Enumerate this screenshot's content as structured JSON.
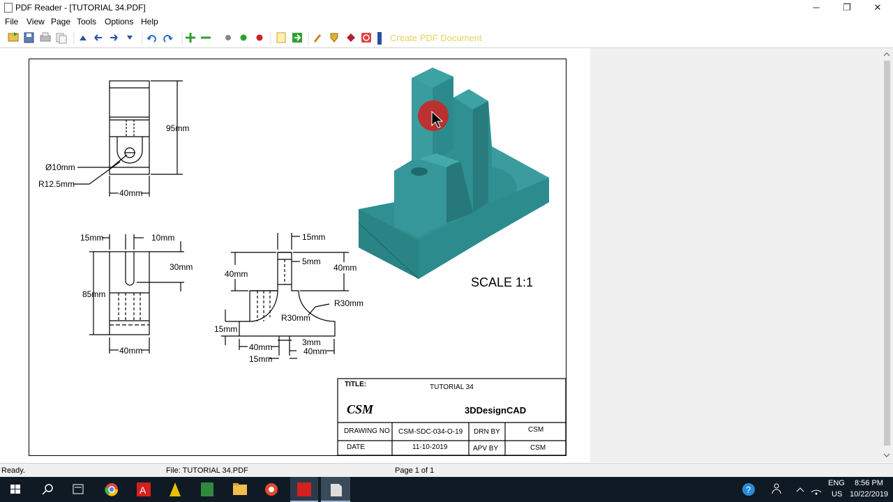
{
  "window": {
    "title": "PDF Reader - [TUTORIAL 34.PDF]",
    "minimize_glyph": "─",
    "restore_glyph": "❐",
    "close_glyph": "✕"
  },
  "menu": [
    "File",
    "View",
    "Page",
    "Tools",
    "Options",
    "Help"
  ],
  "toolbar": {
    "icons": [
      "open-icon",
      "save-icon",
      "print-icon",
      "copy-icon",
      "first-page-icon",
      "prev-page-icon",
      "next-page-icon",
      "dropdown-icon",
      "undo-icon",
      "redo-icon",
      "zoom-in-icon",
      "zoom-out-icon",
      "fit-icon",
      "green-dot-icon",
      "red-dot-icon",
      "page-icon",
      "export-icon",
      "tools-icon",
      "shield-icon",
      "ruby-icon",
      "power-icon"
    ],
    "create_pdf_label": "Create PDF Document"
  },
  "drawing": {
    "top_view": {
      "dim_height": "95mm",
      "dim_hole": "Ø10mm",
      "dim_radius": "R12.5mm",
      "dim_width": "40mm"
    },
    "side_view": {
      "dim_left": "15mm",
      "dim_slot": "10mm",
      "dim_slot_depth": "30mm",
      "dim_height": "85mm",
      "dim_width": "40mm"
    },
    "front_view": {
      "dim_top": "15mm",
      "dim_inner": "5mm",
      "dim_left_h": "40mm",
      "dim_right_h": "40mm",
      "dim_r_right": "R30mm",
      "dim_r_left": "R30mm",
      "dim_base_h": "15mm",
      "dim_left_w": "40mm",
      "dim_step": "3mm",
      "dim_right_w": "40mm",
      "dim_center_w": "15mm"
    },
    "scale": "SCALE 1:1",
    "colors": {
      "model": "#2f8f91",
      "model_dark": "#236e70",
      "model_light": "#3fa3a5",
      "cursor_highlight": "#d42020"
    }
  },
  "title_block": {
    "title_label": "TITLE:",
    "title_value": "TUTORIAL 34",
    "logo": "CSM",
    "company": "3DDesignCAD",
    "drawing_no_label": "DRAWING NO",
    "drawing_no_value": "CSM-SDC-034-O-19",
    "drn_by_label": "DRN BY",
    "drn_by_value": "CSM",
    "date_label": "DATE",
    "date_value": "11-10-2019",
    "apv_by_label": "APV BY",
    "apv_by_value": "CSM"
  },
  "status": {
    "ready": "Ready.",
    "file": "File: TUTORIAL 34.PDF",
    "page": "Page 1 of 1"
  },
  "taskbar": {
    "apps": [
      "windows-start-icon",
      "search-icon",
      "task-view-icon",
      "chrome-icon",
      "acrobat-icon",
      "autocad-icon",
      "dwg-icon",
      "file-explorer-icon",
      "recorder-icon",
      "solidworks-icon",
      "pdf-reader-icon"
    ],
    "lang_top": "ENG",
    "lang_bottom": "US",
    "time": "8:56 PM",
    "date": "10/22/2019"
  }
}
